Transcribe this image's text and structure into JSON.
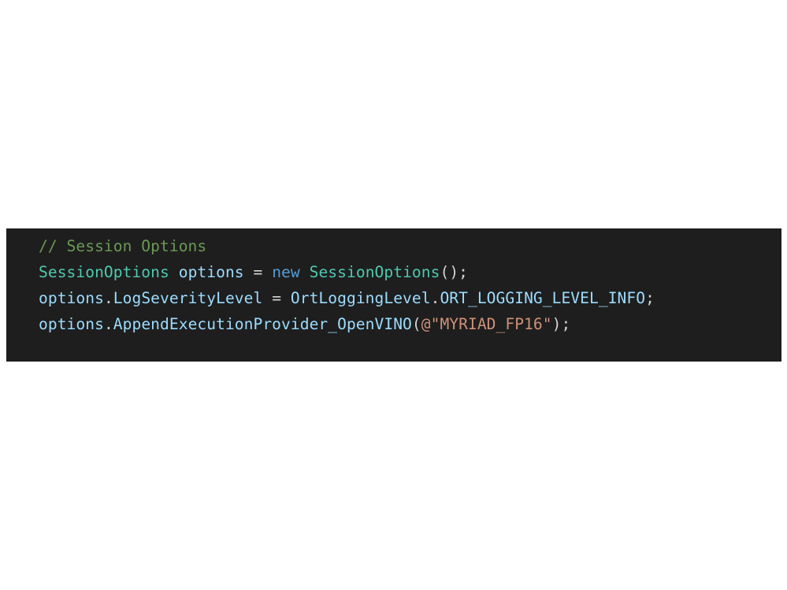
{
  "code_block": {
    "language": "csharp",
    "theme_colors": {
      "background": "#1e1e1e",
      "comment": "#6a9955",
      "type": "#4ec9b0",
      "variable": "#9cdcfe",
      "keyword": "#569cd6",
      "operator": "#d4d4d4",
      "string": "#ce9178"
    },
    "lines": [
      {
        "tokens": [
          {
            "text": "// Session Options",
            "kind": "comment"
          }
        ]
      },
      {
        "tokens": [
          {
            "text": "SessionOptions",
            "kind": "type"
          },
          {
            "text": " ",
            "kind": "op"
          },
          {
            "text": "options",
            "kind": "var"
          },
          {
            "text": " = ",
            "kind": "op"
          },
          {
            "text": "new",
            "kind": "keyword"
          },
          {
            "text": " ",
            "kind": "op"
          },
          {
            "text": "SessionOptions",
            "kind": "type"
          },
          {
            "text": "();",
            "kind": "punct"
          }
        ]
      },
      {
        "tokens": [
          {
            "text": "options",
            "kind": "var"
          },
          {
            "text": ".",
            "kind": "punct"
          },
          {
            "text": "LogSeverityLevel",
            "kind": "var"
          },
          {
            "text": " = ",
            "kind": "op"
          },
          {
            "text": "OrtLoggingLevel",
            "kind": "var"
          },
          {
            "text": ".",
            "kind": "punct"
          },
          {
            "text": "ORT_LOGGING_LEVEL_INFO",
            "kind": "var"
          },
          {
            "text": ";",
            "kind": "punct"
          }
        ]
      },
      {
        "tokens": [
          {
            "text": "options",
            "kind": "var"
          },
          {
            "text": ".",
            "kind": "punct"
          },
          {
            "text": "AppendExecutionProvider_OpenVINO",
            "kind": "var"
          },
          {
            "text": "(",
            "kind": "punct"
          },
          {
            "text": "@\"MYRIAD_FP16\"",
            "kind": "string"
          },
          {
            "text": ");",
            "kind": "punct"
          }
        ]
      }
    ]
  }
}
